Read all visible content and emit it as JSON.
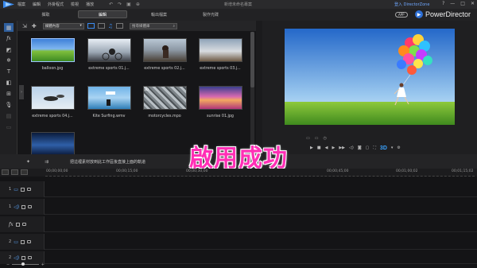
{
  "menu": {
    "items": [
      "檔案",
      "編輯",
      "外掛程式",
      "檢視",
      "播放"
    ],
    "project_title": "新增未命名專案",
    "login": "登入 DirectorZone",
    "window_controls": [
      "?",
      "—",
      "□",
      "✕"
    ]
  },
  "modes": {
    "tabs": [
      "擷取",
      "編輯",
      "輸出檔案",
      "製作光碟"
    ],
    "active": "編輯"
  },
  "brand": {
    "app_badge": "APP",
    "name": "PowerDirector"
  },
  "library": {
    "filter_label": "媒體內容",
    "search_placeholder": "搜尋媒體庫",
    "items": [
      {
        "label": "balloon.jpg"
      },
      {
        "label": "extreme sports 01.j..."
      },
      {
        "label": "extreme sports 02.j..."
      },
      {
        "label": "extreme sports 03.j..."
      },
      {
        "label": "extreme sports 04.j..."
      },
      {
        "label": "Kite Surfing.wmv"
      },
      {
        "label": "motorcycles.mpo",
        "badge": "3D"
      },
      {
        "label": "sunrise 01.jpg"
      },
      {
        "label": ""
      }
    ]
  },
  "preview": {
    "three_d_label": "3D"
  },
  "banner": {
    "text": "啟用成功"
  },
  "timeline": {
    "hint": "把這裡素材放到此工作區後直接上面的軌道",
    "ruler": [
      "00;00;00;00",
      "00;00;15;00",
      "00;00;30;00",
      "00;00;45;00",
      "00;01;00;02",
      "00;01;15;02"
    ],
    "tracks": [
      {
        "num": "1",
        "type": "video"
      },
      {
        "num": "1",
        "type": "audio"
      },
      {
        "num": "",
        "type": "fx"
      },
      {
        "num": "2",
        "type": "video"
      },
      {
        "num": "2",
        "type": "audio"
      }
    ]
  },
  "colors": {
    "accent": "#3a8bf0",
    "banner": "#ff2fb5",
    "brand_blue": "#2d6fd6"
  }
}
